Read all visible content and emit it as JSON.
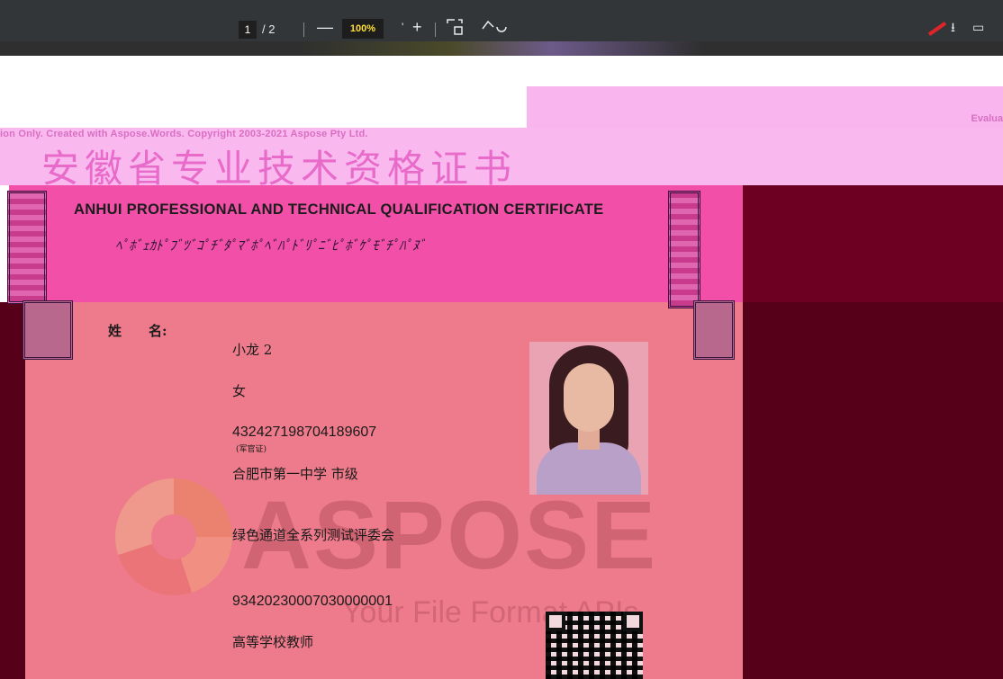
{
  "viewer": {
    "page_current": "1",
    "page_total": "/ 2",
    "zoom_label": "100%",
    "icons": [
      "minus-icon",
      "plus-icon",
      "fit-page-icon",
      "rotate-icon",
      "download-icon",
      "more-icon"
    ]
  },
  "watermark": {
    "evaluation_left": "ion Only. Created with Aspose.Words. Copyright 2003-2021 Aspose Pty Ltd.",
    "evaluation_right": "Evalua",
    "logo_text": "ASPOSE",
    "logo_subtext": "Your File Format APIs"
  },
  "certificate": {
    "title_cn": "安徽省专业技术资格证书",
    "title_en": "ANHUI PROFESSIONAL AND TECHNICAL QUALIFICATION CERTIFICATE",
    "squiggle_line": "ﾍﾟﾎﾞｪｶﾄﾟﾌﾞﾂﾞｺﾟﾁﾞﾀﾟﾏﾞﾎﾟﾍﾞﾊﾟﾄﾞﾘﾟﾆﾞﾋﾟﾎﾞｹﾟﾓﾞﾁﾟﾊﾟﾇﾞ",
    "fields": {
      "name_label": "姓　　名:",
      "name": "小龙 2",
      "gender": "女",
      "id_number": "432427198704189607",
      "id_note": "(军官证)",
      "work_unit": "合肥市第一中学 市级",
      "committee": "绿色通道全系列测试评委会",
      "cert_number": "93420230007030000001",
      "qualification": "高等学校教师"
    }
  },
  "colors": {
    "toolbar": "#323639",
    "cert_background": "#ee7b8b",
    "cert_top": "#f24fa8",
    "dark_side": "#560019",
    "watermark": "#c85d6c"
  }
}
